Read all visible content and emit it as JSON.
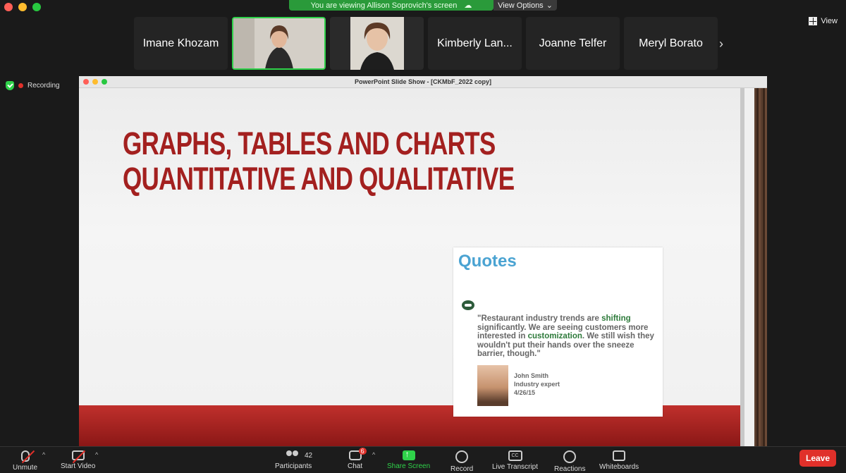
{
  "banner": {
    "viewing_text": "You are viewing Allison Soprovich's screen",
    "view_options": "View Options",
    "view_label": "View"
  },
  "participants": [
    {
      "name": "Imane Khozam"
    },
    {
      "name": ""
    },
    {
      "name": ""
    },
    {
      "name": "Kimberly Lan..."
    },
    {
      "name": "Joanne Telfer"
    },
    {
      "name": "Meryl Borato"
    }
  ],
  "status": {
    "recording": "Recording"
  },
  "ppt": {
    "window_title": "PowerPoint Slide Show - [CKMbF_2022 copy]",
    "slide_title_line1": "GRAPHS, TABLES AND CHARTS",
    "slide_title_line2": "QUANTITATIVE AND QUALITATIVE",
    "quote": {
      "heading": "Quotes",
      "part1": "\"Restaurant industry trends are ",
      "hl1": "shifting",
      "part2": " significantly. We are seeing customers more interested in ",
      "hl2": "customization",
      "part3": ". We still wish they wouldn't put their hands over the sneeze barrier, though.\"",
      "author_name": "John Smith",
      "author_role": "Industry expert",
      "author_date": "4/26/15"
    }
  },
  "toolbar": {
    "unmute": "Unmute",
    "start_video": "Start Video",
    "participants_count": "42",
    "participants": "Participants",
    "chat_badge": "6",
    "chat": "Chat",
    "share_screen": "Share Screen",
    "record": "Record",
    "live_transcript": "Live Transcript",
    "cc": "CC",
    "reactions": "Reactions",
    "whiteboards": "Whiteboards",
    "leave": "Leave"
  },
  "colors": {
    "accent_green": "#2fd24a",
    "slide_red": "#a3201f",
    "leave_red": "#e0302a",
    "quote_blue": "#4aa3d2"
  }
}
